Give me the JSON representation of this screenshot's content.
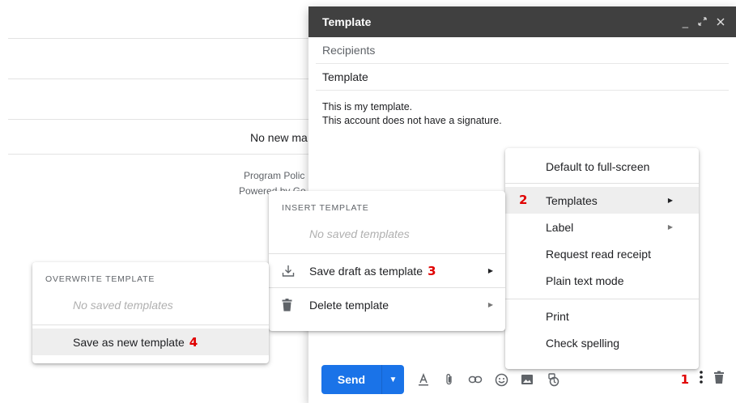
{
  "background": {
    "message": "No new ma",
    "footer_line1": "Program Polic",
    "footer_line2": "Powered by Go"
  },
  "compose": {
    "title": "Template",
    "header_icons": [
      "minimize-icon",
      "expand-icon",
      "close-icon"
    ],
    "recipients_placeholder": "Recipients",
    "subject": "Template",
    "body_line1": "This is my template.",
    "body_line2": "This account does not have a signature.",
    "send_label": "Send",
    "toolbar_icons": [
      "text-format-icon",
      "attach-icon",
      "link-icon",
      "emoji-icon",
      "photo-icon",
      "schedule-icon"
    ],
    "more_icon": "more-vert-icon",
    "discard_icon": "trash-icon"
  },
  "step_labels": {
    "step1": "1",
    "step2": "2",
    "step3": "3",
    "step4": "4"
  },
  "more_menu": {
    "items": [
      {
        "label": "Default to full-screen"
      },
      {
        "label": "Templates"
      },
      {
        "label": "Label"
      },
      {
        "label": "Request read receipt"
      },
      {
        "label": "Plain text mode"
      },
      {
        "label": "Print"
      },
      {
        "label": "Check spelling"
      }
    ]
  },
  "templates_menu": {
    "heading": "INSERT TEMPLATE",
    "empty": "No saved templates",
    "save_draft": "Save draft as template",
    "delete": "Delete template"
  },
  "overwrite_menu": {
    "heading": "OVERWRITE TEMPLATE",
    "empty": "No saved templates",
    "save_new": "Save as new template"
  },
  "colors": {
    "accent": "#1a73e8",
    "header": "#404040",
    "annotation": "#e00000"
  }
}
